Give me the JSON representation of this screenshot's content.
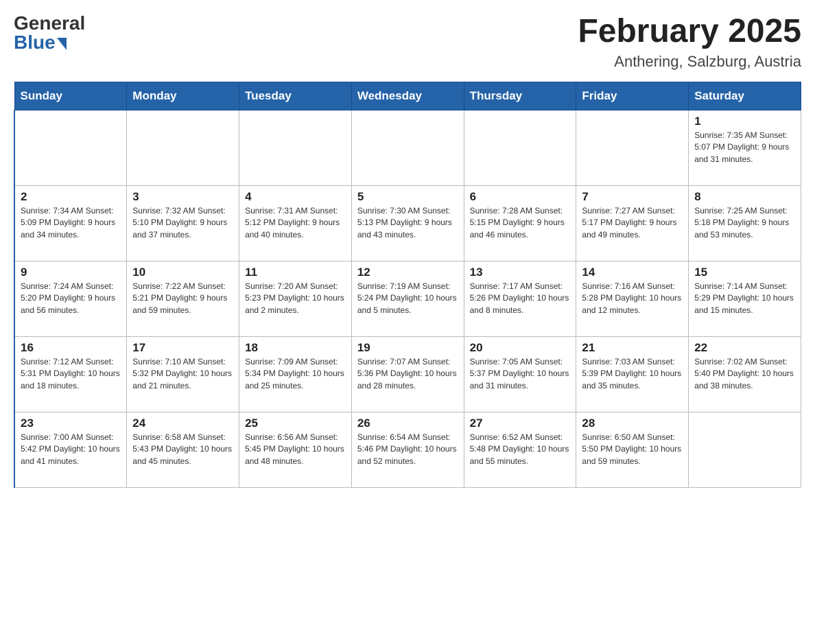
{
  "header": {
    "logo_general": "General",
    "logo_blue": "Blue",
    "title": "February 2025",
    "subtitle": "Anthering, Salzburg, Austria"
  },
  "days": [
    "Sunday",
    "Monday",
    "Tuesday",
    "Wednesday",
    "Thursday",
    "Friday",
    "Saturday"
  ],
  "weeks": [
    [
      {
        "day": "",
        "info": ""
      },
      {
        "day": "",
        "info": ""
      },
      {
        "day": "",
        "info": ""
      },
      {
        "day": "",
        "info": ""
      },
      {
        "day": "",
        "info": ""
      },
      {
        "day": "",
        "info": ""
      },
      {
        "day": "1",
        "info": "Sunrise: 7:35 AM\nSunset: 5:07 PM\nDaylight: 9 hours and 31 minutes."
      }
    ],
    [
      {
        "day": "2",
        "info": "Sunrise: 7:34 AM\nSunset: 5:09 PM\nDaylight: 9 hours and 34 minutes."
      },
      {
        "day": "3",
        "info": "Sunrise: 7:32 AM\nSunset: 5:10 PM\nDaylight: 9 hours and 37 minutes."
      },
      {
        "day": "4",
        "info": "Sunrise: 7:31 AM\nSunset: 5:12 PM\nDaylight: 9 hours and 40 minutes."
      },
      {
        "day": "5",
        "info": "Sunrise: 7:30 AM\nSunset: 5:13 PM\nDaylight: 9 hours and 43 minutes."
      },
      {
        "day": "6",
        "info": "Sunrise: 7:28 AM\nSunset: 5:15 PM\nDaylight: 9 hours and 46 minutes."
      },
      {
        "day": "7",
        "info": "Sunrise: 7:27 AM\nSunset: 5:17 PM\nDaylight: 9 hours and 49 minutes."
      },
      {
        "day": "8",
        "info": "Sunrise: 7:25 AM\nSunset: 5:18 PM\nDaylight: 9 hours and 53 minutes."
      }
    ],
    [
      {
        "day": "9",
        "info": "Sunrise: 7:24 AM\nSunset: 5:20 PM\nDaylight: 9 hours and 56 minutes."
      },
      {
        "day": "10",
        "info": "Sunrise: 7:22 AM\nSunset: 5:21 PM\nDaylight: 9 hours and 59 minutes."
      },
      {
        "day": "11",
        "info": "Sunrise: 7:20 AM\nSunset: 5:23 PM\nDaylight: 10 hours and 2 minutes."
      },
      {
        "day": "12",
        "info": "Sunrise: 7:19 AM\nSunset: 5:24 PM\nDaylight: 10 hours and 5 minutes."
      },
      {
        "day": "13",
        "info": "Sunrise: 7:17 AM\nSunset: 5:26 PM\nDaylight: 10 hours and 8 minutes."
      },
      {
        "day": "14",
        "info": "Sunrise: 7:16 AM\nSunset: 5:28 PM\nDaylight: 10 hours and 12 minutes."
      },
      {
        "day": "15",
        "info": "Sunrise: 7:14 AM\nSunset: 5:29 PM\nDaylight: 10 hours and 15 minutes."
      }
    ],
    [
      {
        "day": "16",
        "info": "Sunrise: 7:12 AM\nSunset: 5:31 PM\nDaylight: 10 hours and 18 minutes."
      },
      {
        "day": "17",
        "info": "Sunrise: 7:10 AM\nSunset: 5:32 PM\nDaylight: 10 hours and 21 minutes."
      },
      {
        "day": "18",
        "info": "Sunrise: 7:09 AM\nSunset: 5:34 PM\nDaylight: 10 hours and 25 minutes."
      },
      {
        "day": "19",
        "info": "Sunrise: 7:07 AM\nSunset: 5:36 PM\nDaylight: 10 hours and 28 minutes."
      },
      {
        "day": "20",
        "info": "Sunrise: 7:05 AM\nSunset: 5:37 PM\nDaylight: 10 hours and 31 minutes."
      },
      {
        "day": "21",
        "info": "Sunrise: 7:03 AM\nSunset: 5:39 PM\nDaylight: 10 hours and 35 minutes."
      },
      {
        "day": "22",
        "info": "Sunrise: 7:02 AM\nSunset: 5:40 PM\nDaylight: 10 hours and 38 minutes."
      }
    ],
    [
      {
        "day": "23",
        "info": "Sunrise: 7:00 AM\nSunset: 5:42 PM\nDaylight: 10 hours and 41 minutes."
      },
      {
        "day": "24",
        "info": "Sunrise: 6:58 AM\nSunset: 5:43 PM\nDaylight: 10 hours and 45 minutes."
      },
      {
        "day": "25",
        "info": "Sunrise: 6:56 AM\nSunset: 5:45 PM\nDaylight: 10 hours and 48 minutes."
      },
      {
        "day": "26",
        "info": "Sunrise: 6:54 AM\nSunset: 5:46 PM\nDaylight: 10 hours and 52 minutes."
      },
      {
        "day": "27",
        "info": "Sunrise: 6:52 AM\nSunset: 5:48 PM\nDaylight: 10 hours and 55 minutes."
      },
      {
        "day": "28",
        "info": "Sunrise: 6:50 AM\nSunset: 5:50 PM\nDaylight: 10 hours and 59 minutes."
      },
      {
        "day": "",
        "info": ""
      }
    ]
  ]
}
